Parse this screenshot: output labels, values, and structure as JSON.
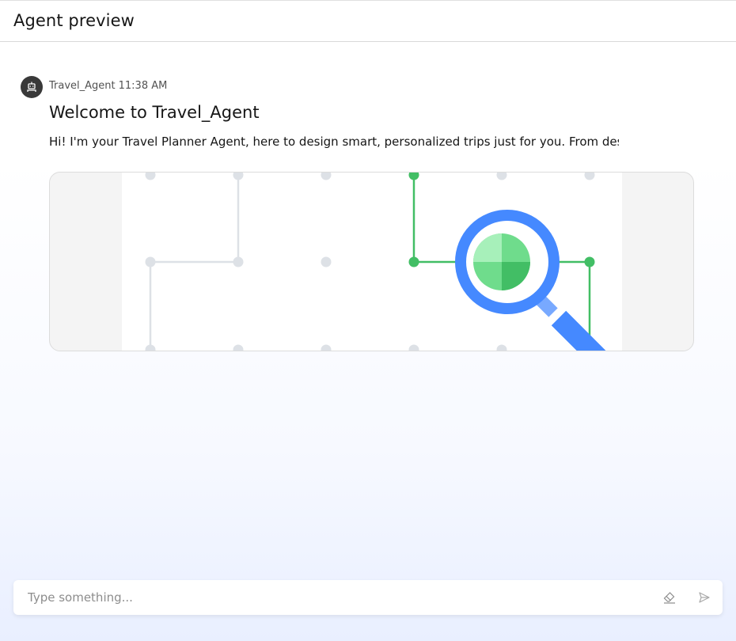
{
  "header": {
    "title": "Agent preview"
  },
  "message": {
    "agent_name": "Travel_Agent",
    "time": "11:38 AM",
    "avatar_icon": "robot-icon",
    "title": "Welcome to Travel_Agent",
    "text": "Hi! I'm your Travel Planner Agent, here to design smart, personalized trips just for you. From desti",
    "image": {
      "colors": {
        "grid": "#dde1e6",
        "path": "#42be65",
        "magnifier": "#4589ff",
        "lens_fill": "#6fdc8c"
      }
    }
  },
  "composer": {
    "placeholder": "Type something...",
    "clear_icon": "eraser-icon",
    "send_icon": "send-icon"
  }
}
